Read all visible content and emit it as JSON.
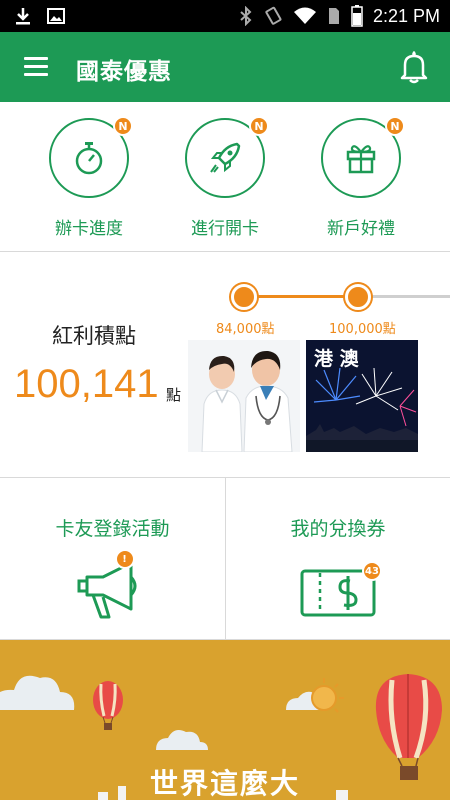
{
  "status_bar": {
    "time": "2:21 PM",
    "icons": [
      "download-icon",
      "image-icon",
      "bluetooth-icon",
      "vibrate-icon",
      "wifi-icon",
      "sim-icon",
      "battery-icon"
    ]
  },
  "app_bar": {
    "title": "國泰優惠",
    "menu_icon": "menu-icon",
    "bell_icon": "bell-icon"
  },
  "quick_actions": [
    {
      "label": "辦卡進度",
      "icon": "stopwatch-icon",
      "badge": "N"
    },
    {
      "label": "進行開卡",
      "icon": "rocket-icon",
      "badge": "N"
    },
    {
      "label": "新戶好禮",
      "icon": "gift-icon",
      "badge": "N"
    }
  ],
  "points": {
    "title": "紅利積點",
    "value": "100,141",
    "unit": "點",
    "milestones": [
      {
        "label": "84,000點",
        "image_text": ""
      },
      {
        "label": "100,000點",
        "image_text": "港 澳"
      }
    ]
  },
  "cards": [
    {
      "label": "卡友登錄活動",
      "icon": "megaphone-icon",
      "badge": "!"
    },
    {
      "label": "我的兌換券",
      "icon": "voucher-icon",
      "badge": "43"
    }
  ],
  "banner": {
    "title": "世界這麼大"
  },
  "colors": {
    "primary_green": "#1d9a55",
    "accent_orange": "#ee8a1b",
    "banner_gold": "#d9a22e"
  }
}
